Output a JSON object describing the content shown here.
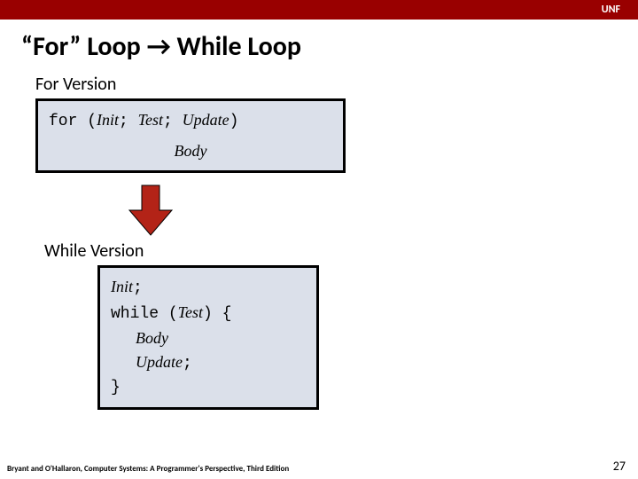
{
  "header": {
    "tag": "UNF"
  },
  "title": {
    "quote_open": "“",
    "word_for": "For",
    "quote_close": "”",
    "loop1": " Loop ",
    "arrow": "→",
    "loop2": " While Loop"
  },
  "for_section": {
    "label": "For Version",
    "kw_for": "for ",
    "lparen": "(",
    "init": "Init",
    "semi1": "; ",
    "test": "Test",
    "semi2": "; ",
    "update": "Update",
    "rparen": ")",
    "body": "Body"
  },
  "while_section": {
    "label": "While Version",
    "init": "Init",
    "semi_init": ";",
    "kw_while": "while ",
    "lparen": "(",
    "test": "Test",
    "rparen": ") ",
    "lbrace": "{",
    "body": "Body",
    "update": "Update",
    "semi_update": ";",
    "rbrace": "}"
  },
  "footer": {
    "left": "Bryant and O'Hallaron, Computer Systems: A Programmer's Perspective, Third Edition",
    "page": "27"
  },
  "colors": {
    "accent": "#990000",
    "arrow": "#b32317"
  }
}
